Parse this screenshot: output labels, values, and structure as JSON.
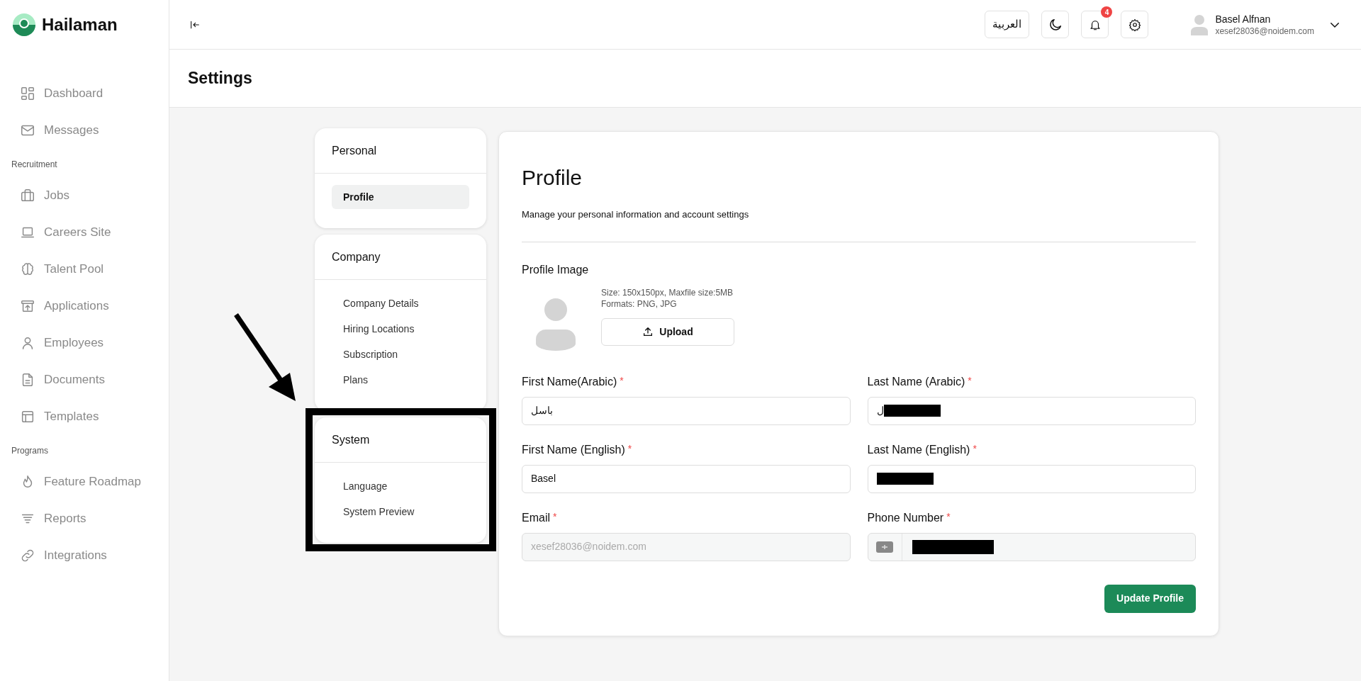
{
  "brand": {
    "name": "Hailaman"
  },
  "sidebar": {
    "groups": [
      {
        "items": [
          {
            "label": "Dashboard"
          },
          {
            "label": "Messages"
          }
        ]
      },
      {
        "heading": "Recruitment",
        "items": [
          {
            "label": "Jobs"
          },
          {
            "label": "Careers Site"
          },
          {
            "label": "Talent Pool"
          },
          {
            "label": "Applications"
          },
          {
            "label": "Employees"
          },
          {
            "label": "Documents"
          },
          {
            "label": "Templates"
          }
        ]
      },
      {
        "heading": "Programs",
        "items": [
          {
            "label": "Feature Roadmap"
          },
          {
            "label": "Reports"
          },
          {
            "label": "Integrations"
          }
        ]
      }
    ]
  },
  "header": {
    "language_button": "العربية",
    "notification_count": "4",
    "user": {
      "name": "Basel Alfnan",
      "email": "xesef28036@noidem.com"
    }
  },
  "page_title": "Settings",
  "settings_nav": [
    {
      "title": "Personal",
      "items": [
        {
          "label": "Profile",
          "selected": true
        }
      ]
    },
    {
      "title": "Company",
      "items": [
        {
          "label": "Company Details",
          "selected": false
        },
        {
          "label": "Hiring Locations",
          "selected": false
        },
        {
          "label": "Subscription",
          "selected": false
        },
        {
          "label": "Plans",
          "selected": false
        }
      ]
    },
    {
      "title": "System",
      "highlighted": true,
      "items": [
        {
          "label": "Language",
          "selected": false
        },
        {
          "label": "System Preview",
          "selected": false
        }
      ]
    }
  ],
  "profile": {
    "title": "Profile",
    "subtitle": "Manage your personal information and account settings",
    "image_label": "Profile Image",
    "image_hint": [
      "Size: 150x150px, Maxfile size:5MB",
      "Formats: PNG, JPG"
    ],
    "upload_button": "Upload",
    "fields": [
      {
        "kind": "text",
        "label": "First Name(Arabic)",
        "required_mark": "*",
        "value": "باسل",
        "disabled": false,
        "redacted": false
      },
      {
        "kind": "text",
        "label": "Last Name (Arabic)",
        "required_mark": "*",
        "value": "ل",
        "disabled": false,
        "redacted": true
      },
      {
        "kind": "text",
        "label": "First Name (English)",
        "required_mark": "*",
        "value": "Basel",
        "disabled": false,
        "redacted": false
      },
      {
        "kind": "text",
        "label": "Last Name (English)",
        "required_mark": "*",
        "disabled": false,
        "redacted": true
      },
      {
        "kind": "text",
        "label": "Email",
        "required_mark": "*",
        "value": "xesef28036@noidem.com",
        "disabled": true,
        "redacted": false
      },
      {
        "kind": "phone",
        "label": "Phone Number",
        "required_mark": "*",
        "disabled": true,
        "redacted": true
      }
    ],
    "submit_button": "Update Profile"
  },
  "annotations": [
    {
      "kind": "arrow"
    }
  ]
}
